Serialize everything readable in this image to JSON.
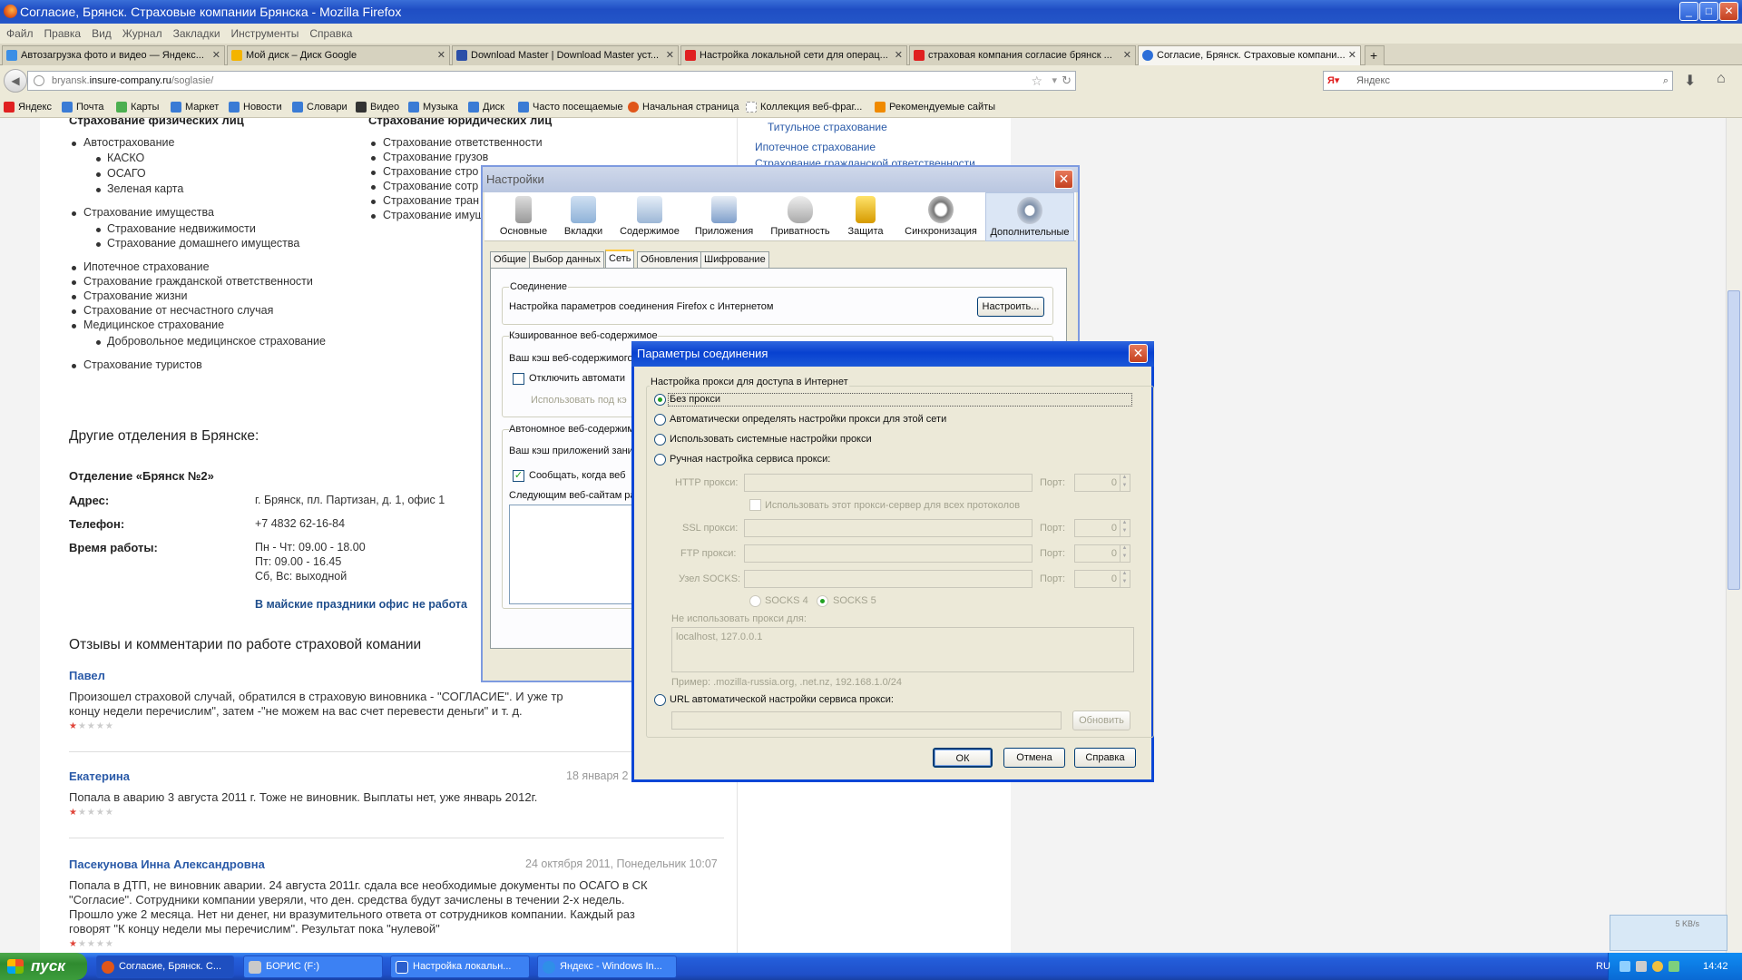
{
  "window": {
    "title": "Согласие, Брянск. Страховые компании Брянска - Mozilla Firefox"
  },
  "menu": [
    "Файл",
    "Правка",
    "Вид",
    "Журнал",
    "Закладки",
    "Инструменты",
    "Справка"
  ],
  "tabs": [
    {
      "label": "Автозагрузка фото и видео — Яндекс...",
      "color": "#3a8ee6"
    },
    {
      "label": "Мой диск – Диск Google",
      "color": "#f4b400"
    },
    {
      "label": "Download Master | Download Master уст...",
      "color": "#2b4fa8"
    },
    {
      "label": "Настройка локальной сети для операц...",
      "color": "#e02020"
    },
    {
      "label": "страховая компания согласие брянск ...",
      "color": "#e02020"
    },
    {
      "label": "Согласие, Брянск. Страховые компани...",
      "color": "#2d6fd8"
    }
  ],
  "nav": {
    "url_prefix": "bryansk.",
    "url_host": "insure-company.ru",
    "url_path": "/soglasie/",
    "search_placeholder": "Яндекс"
  },
  "bookmarks": [
    {
      "label": "Яндекс",
      "color": "#e02020"
    },
    {
      "label": "Почта",
      "color": "#3a7bd5"
    },
    {
      "label": "Карты",
      "color": "#4caf50"
    },
    {
      "label": "Маркет",
      "color": "#3a7bd5"
    },
    {
      "label": "Новости",
      "color": "#3a7bd5"
    },
    {
      "label": "Словари",
      "color": "#3a7bd5"
    },
    {
      "label": "Видео",
      "color": "#333333"
    },
    {
      "label": "Музыка",
      "color": "#3a7bd5"
    },
    {
      "label": "Диск",
      "color": "#3a7bd5"
    },
    {
      "label": "Часто посещаемые",
      "color": "#3a7bd5"
    },
    {
      "label": "Начальная страница",
      "color": "#e0561a"
    },
    {
      "label": "Коллекция веб-фраг...",
      "color": "#aaaaaa"
    },
    {
      "label": "Рекомендуемые сайты",
      "color": "#f08a00"
    }
  ],
  "page": {
    "col1_heading": "Страхование физических лиц",
    "col1": [
      {
        "text": "Автострахование",
        "sub": [
          "КАСКО",
          "ОСАГО",
          "Зеленая карта"
        ]
      },
      {
        "text": "Страхование имущества",
        "sub": [
          "Страхование недвижимости",
          "Страхование домашнего имущества"
        ]
      },
      {
        "text": "Ипотечное страхование"
      },
      {
        "text": "Страхование гражданской ответственности"
      },
      {
        "text": "Страхование жизни"
      },
      {
        "text": "Страхование от несчастного случая"
      },
      {
        "text": "Медицинское страхование",
        "sub": [
          "Добровольное медицинское страхование"
        ]
      },
      {
        "text": "Страхование туристов"
      }
    ],
    "col2_heading": "Страхование юридических лиц",
    "col2": [
      "Страхование ответственности",
      "Страхование грузов",
      "Страхование стро",
      "Страхование сотр",
      "Страхование тран",
      "Страхование имущ"
    ],
    "sidebar_links": [
      "Титульное страхование",
      "Ипотечное страхование",
      "Страхование гражданской ответственности"
    ],
    "branches_heading": "Другие отделения в Брянске:",
    "branch_name": "Отделение «Брянск №2»",
    "address_label": "Адрес:",
    "address_value": "г. Брянск, пл. Партизан, д. 1, офис 1",
    "phone_label": "Телефон:",
    "phone_value": "+7 4832 62-16-84",
    "hours_label": "Время работы:",
    "hours": [
      "Пн - Чт: 09.00 - 18.00",
      "Пт: 09.00 - 16.45",
      "Сб, Вс: выходной"
    ],
    "holiday_note": "В майские праздники офис не работа",
    "reviews_heading": "Отзывы и комментарии по работе страховой комании",
    "reviews": [
      {
        "author": "Павел",
        "date": "",
        "lines": [
          "Произошел страховой случай, обратился в страховую виновника - \"СОГЛАСИЕ\". И уже тр",
          "концу недели перечислим\", затем -\"не можем на вас счет перевести деньги\" и т. д."
        ],
        "rating": 1
      },
      {
        "author": "Екатерина",
        "date": "18 января 2",
        "lines": [
          "Попала в аварию 3 августа 2011 г. Тоже не виновник. Выплаты нет, уже январь 2012г."
        ],
        "rating": 1
      },
      {
        "author": "Пасекунова Инна Александровна",
        "date": "24 октября 2011, Понедельник 10:07",
        "lines": [
          "Попала в ДТП, не виновник аварии. 24 августа 2011г. сдала все необходимые документы по ОСАГО в СК",
          "\"Согласие\". Сотрудники компании уверяли, что ден. средства будут зачислены в течении 2-х недель.",
          "Прошло уже 2 месяца. Нет ни денег, ни вразумительного ответа от сотрудников компании. Каждый раз",
          "говорят \"К концу недели мы перечислим\". Результат пока \"нулевой\""
        ],
        "rating": 1
      }
    ]
  },
  "settings": {
    "title": "Настройки",
    "toolbar": [
      "Основные",
      "Вкладки",
      "Содержимое",
      "Приложения",
      "Приватность",
      "Защита",
      "Синхронизация",
      "Дополнительные"
    ],
    "subtabs": [
      "Общие",
      "Выбор данных",
      "Сеть",
      "Обновления",
      "Шифрование"
    ],
    "connection_group": "Соединение",
    "connection_text": "Настройка параметров соединения Firefox с Интернетом",
    "configure_button": "Настроить...",
    "cache_group": "Кэшированное веб-содержимое",
    "cache_text": "Ваш кэш веб-содержимого",
    "override_check": "Отключить автомати",
    "use_up_to": "Использовать под кэ",
    "offline_group": "Автономное веб-содержим",
    "offline_text": "Ваш кэш приложений зани",
    "notify_check": "Сообщать, когда веб",
    "allowed_sites": "Следующим веб-сайтам ра"
  },
  "connection": {
    "title": "Параметры соединения",
    "group_label": "Настройка прокси для доступа в Интернет",
    "options": [
      "Без прокси",
      "Автоматически определять настройки прокси для этой сети",
      "Использовать системные настройки прокси",
      "Ручная настройка сервиса прокси:"
    ],
    "http_label": "HTTP прокси:",
    "ssl_label": "SSL прокси:",
    "ftp_label": "FTP прокси:",
    "socks_label": "Узел SOCKS:",
    "port_label": "Порт:",
    "port_value": "0",
    "same_proxy": "Использовать этот прокси-сервер для всех протоколов",
    "socks4": "SOCKS 4",
    "socks5": "SOCKS 5",
    "no_proxy_label": "Не использовать прокси для:",
    "no_proxy_value": "localhost, 127.0.0.1",
    "example": "Пример: .mozilla-russia.org, .net.nz, 192.168.1.0/24",
    "auto_url_label": "URL автоматической настройки сервиса прокси:",
    "reload_button": "Обновить",
    "ok_button": "ОК",
    "cancel_button": "Отмена",
    "help_button": "Справка"
  },
  "taskbar": {
    "start": "пуск",
    "tasks": [
      {
        "label": "Согласие, Брянск. С...",
        "color": "#e0561a"
      },
      {
        "label": "БОРИС (F:)",
        "color": "#c9c9c9"
      },
      {
        "label": "Настройка локальн...",
        "color": "#2b5fcc"
      },
      {
        "label": "Яндекс - Windows In...",
        "color": "#2f8fe8"
      }
    ],
    "lang": "RU",
    "time": "14:42",
    "net_speed": "5 KB/s"
  }
}
